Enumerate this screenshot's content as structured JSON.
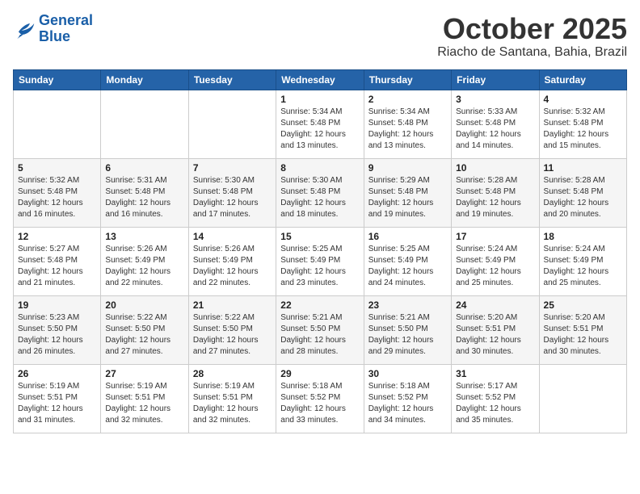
{
  "logo": {
    "line1": "General",
    "line2": "Blue"
  },
  "title": "October 2025",
  "subtitle": "Riacho de Santana, Bahia, Brazil",
  "weekdays": [
    "Sunday",
    "Monday",
    "Tuesday",
    "Wednesday",
    "Thursday",
    "Friday",
    "Saturday"
  ],
  "weeks": [
    [
      {
        "day": "",
        "info": ""
      },
      {
        "day": "",
        "info": ""
      },
      {
        "day": "",
        "info": ""
      },
      {
        "day": "1",
        "info": "Sunrise: 5:34 AM\nSunset: 5:48 PM\nDaylight: 12 hours\nand 13 minutes."
      },
      {
        "day": "2",
        "info": "Sunrise: 5:34 AM\nSunset: 5:48 PM\nDaylight: 12 hours\nand 13 minutes."
      },
      {
        "day": "3",
        "info": "Sunrise: 5:33 AM\nSunset: 5:48 PM\nDaylight: 12 hours\nand 14 minutes."
      },
      {
        "day": "4",
        "info": "Sunrise: 5:32 AM\nSunset: 5:48 PM\nDaylight: 12 hours\nand 15 minutes."
      }
    ],
    [
      {
        "day": "5",
        "info": "Sunrise: 5:32 AM\nSunset: 5:48 PM\nDaylight: 12 hours\nand 16 minutes."
      },
      {
        "day": "6",
        "info": "Sunrise: 5:31 AM\nSunset: 5:48 PM\nDaylight: 12 hours\nand 16 minutes."
      },
      {
        "day": "7",
        "info": "Sunrise: 5:30 AM\nSunset: 5:48 PM\nDaylight: 12 hours\nand 17 minutes."
      },
      {
        "day": "8",
        "info": "Sunrise: 5:30 AM\nSunset: 5:48 PM\nDaylight: 12 hours\nand 18 minutes."
      },
      {
        "day": "9",
        "info": "Sunrise: 5:29 AM\nSunset: 5:48 PM\nDaylight: 12 hours\nand 19 minutes."
      },
      {
        "day": "10",
        "info": "Sunrise: 5:28 AM\nSunset: 5:48 PM\nDaylight: 12 hours\nand 19 minutes."
      },
      {
        "day": "11",
        "info": "Sunrise: 5:28 AM\nSunset: 5:48 PM\nDaylight: 12 hours\nand 20 minutes."
      }
    ],
    [
      {
        "day": "12",
        "info": "Sunrise: 5:27 AM\nSunset: 5:48 PM\nDaylight: 12 hours\nand 21 minutes."
      },
      {
        "day": "13",
        "info": "Sunrise: 5:26 AM\nSunset: 5:49 PM\nDaylight: 12 hours\nand 22 minutes."
      },
      {
        "day": "14",
        "info": "Sunrise: 5:26 AM\nSunset: 5:49 PM\nDaylight: 12 hours\nand 22 minutes."
      },
      {
        "day": "15",
        "info": "Sunrise: 5:25 AM\nSunset: 5:49 PM\nDaylight: 12 hours\nand 23 minutes."
      },
      {
        "day": "16",
        "info": "Sunrise: 5:25 AM\nSunset: 5:49 PM\nDaylight: 12 hours\nand 24 minutes."
      },
      {
        "day": "17",
        "info": "Sunrise: 5:24 AM\nSunset: 5:49 PM\nDaylight: 12 hours\nand 25 minutes."
      },
      {
        "day": "18",
        "info": "Sunrise: 5:24 AM\nSunset: 5:49 PM\nDaylight: 12 hours\nand 25 minutes."
      }
    ],
    [
      {
        "day": "19",
        "info": "Sunrise: 5:23 AM\nSunset: 5:50 PM\nDaylight: 12 hours\nand 26 minutes."
      },
      {
        "day": "20",
        "info": "Sunrise: 5:22 AM\nSunset: 5:50 PM\nDaylight: 12 hours\nand 27 minutes."
      },
      {
        "day": "21",
        "info": "Sunrise: 5:22 AM\nSunset: 5:50 PM\nDaylight: 12 hours\nand 27 minutes."
      },
      {
        "day": "22",
        "info": "Sunrise: 5:21 AM\nSunset: 5:50 PM\nDaylight: 12 hours\nand 28 minutes."
      },
      {
        "day": "23",
        "info": "Sunrise: 5:21 AM\nSunset: 5:50 PM\nDaylight: 12 hours\nand 29 minutes."
      },
      {
        "day": "24",
        "info": "Sunrise: 5:20 AM\nSunset: 5:51 PM\nDaylight: 12 hours\nand 30 minutes."
      },
      {
        "day": "25",
        "info": "Sunrise: 5:20 AM\nSunset: 5:51 PM\nDaylight: 12 hours\nand 30 minutes."
      }
    ],
    [
      {
        "day": "26",
        "info": "Sunrise: 5:19 AM\nSunset: 5:51 PM\nDaylight: 12 hours\nand 31 minutes."
      },
      {
        "day": "27",
        "info": "Sunrise: 5:19 AM\nSunset: 5:51 PM\nDaylight: 12 hours\nand 32 minutes."
      },
      {
        "day": "28",
        "info": "Sunrise: 5:19 AM\nSunset: 5:51 PM\nDaylight: 12 hours\nand 32 minutes."
      },
      {
        "day": "29",
        "info": "Sunrise: 5:18 AM\nSunset: 5:52 PM\nDaylight: 12 hours\nand 33 minutes."
      },
      {
        "day": "30",
        "info": "Sunrise: 5:18 AM\nSunset: 5:52 PM\nDaylight: 12 hours\nand 34 minutes."
      },
      {
        "day": "31",
        "info": "Sunrise: 5:17 AM\nSunset: 5:52 PM\nDaylight: 12 hours\nand 35 minutes."
      },
      {
        "day": "",
        "info": ""
      }
    ]
  ]
}
